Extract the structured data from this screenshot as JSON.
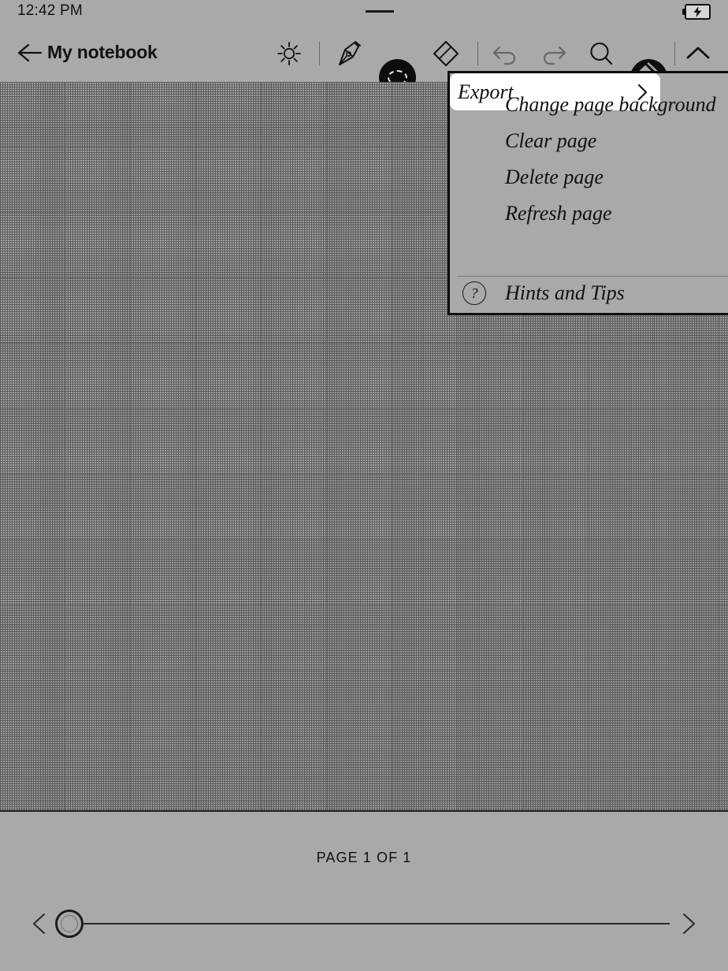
{
  "theme": {
    "background": "#a9a9a9",
    "ink": "#101010",
    "highlight": "#ffffff",
    "grid_major": "#5a5a5a",
    "grid_minor": "#8d8d8d"
  },
  "status_bar": {
    "time": "12:42 PM",
    "battery_icon": "battery-charging-icon",
    "handle_icon": "pulldown-handle-icon"
  },
  "toolbar": {
    "back_icon": "back-arrow-icon",
    "title": "My notebook",
    "tools": [
      {
        "name": "brightness-icon",
        "label": "Brightness",
        "state": "enabled"
      },
      {
        "name": "pen-icon",
        "label": "Pen",
        "state": "enabled"
      },
      {
        "name": "selection-icon",
        "label": "Selection",
        "state": "active"
      },
      {
        "name": "eraser-icon",
        "label": "Eraser",
        "state": "enabled"
      },
      {
        "name": "undo-icon",
        "label": "Undo",
        "state": "disabled"
      },
      {
        "name": "redo-icon",
        "label": "Redo",
        "state": "disabled"
      },
      {
        "name": "search-icon",
        "label": "Search",
        "state": "enabled"
      },
      {
        "name": "more-icon",
        "label": "More options",
        "state": "active"
      },
      {
        "name": "chevron-up-icon",
        "label": "Collapse toolbar",
        "state": "enabled"
      }
    ]
  },
  "more_menu": {
    "items": [
      {
        "label": "Change page background",
        "selected": false,
        "has_submenu": false
      },
      {
        "label": "Clear page",
        "selected": false,
        "has_submenu": false
      },
      {
        "label": "Delete page",
        "selected": false,
        "has_submenu": false
      },
      {
        "label": "Refresh page",
        "selected": false,
        "has_submenu": false
      },
      {
        "label": "Export",
        "selected": true,
        "has_submenu": true
      }
    ],
    "footer_item": {
      "label": "Hints and Tips",
      "icon": "question-mark-icon",
      "icon_glyph": "?"
    }
  },
  "canvas": {
    "background_type": "dotted-grid"
  },
  "footer": {
    "page_indicator": "PAGE 1 OF 1",
    "slider": {
      "prev_icon": "chevron-left-icon",
      "next_icon": "chevron-right-icon",
      "handle_name": "page-slider-handle",
      "position_percent": 0
    }
  }
}
